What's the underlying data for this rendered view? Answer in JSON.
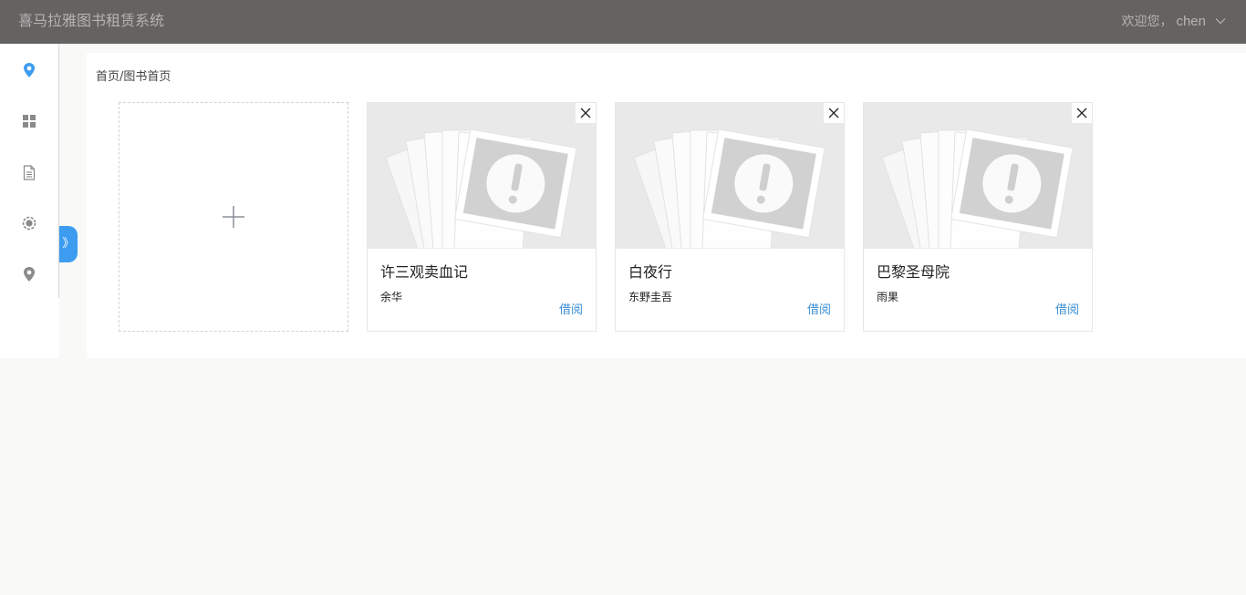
{
  "header": {
    "app_title": "喜马拉雅图书租赁系统",
    "welcome": "欢迎您，",
    "username": "chen"
  },
  "sidebar": {
    "items": [
      {
        "icon": "location-pin-icon",
        "active": true
      },
      {
        "icon": "grid-icon",
        "active": false
      },
      {
        "icon": "document-icon",
        "active": false
      },
      {
        "icon": "settings-icon",
        "active": false
      },
      {
        "icon": "location-pin-icon",
        "active": false
      }
    ],
    "toggle_label": "》"
  },
  "breadcrumb": "首页/图书首页",
  "add_card": {
    "icon": "plus-icon"
  },
  "books": [
    {
      "title": "许三观卖血记",
      "author": "余华",
      "action": "借阅"
    },
    {
      "title": "白夜行",
      "author": "东野圭吾",
      "action": "借阅"
    },
    {
      "title": "巴黎圣母院",
      "author": "雨果",
      "action": "借阅"
    }
  ],
  "colors": {
    "header_bg": "#656262",
    "accent": "#3d9cf0",
    "link": "#3a8fd6",
    "page_bg": "#f9f9f8"
  }
}
